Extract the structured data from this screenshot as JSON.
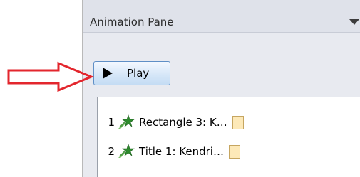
{
  "pane": {
    "title": "Animation Pane"
  },
  "toolbar": {
    "play_label": "Play"
  },
  "animations": [
    {
      "index": "1",
      "label": "Rectangle 3: K…",
      "icon": "entrance-effect-star-icon"
    },
    {
      "index": "2",
      "label": "Title 1: Kendri…",
      "icon": "entrance-effect-star-icon"
    }
  ],
  "colors": {
    "annotation_arrow": "#e3262d",
    "play_border": "#5f8fc6",
    "timing_fill": "#fde9b8"
  }
}
